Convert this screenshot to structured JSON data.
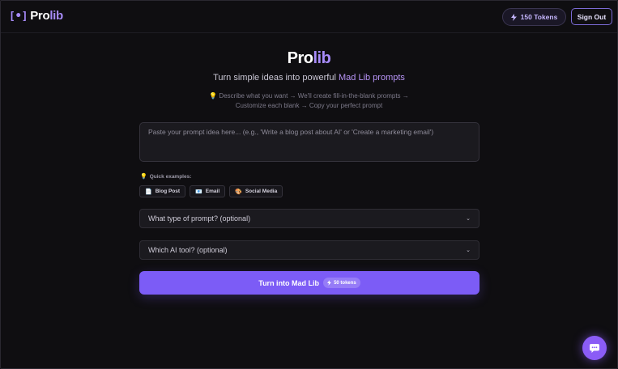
{
  "header": {
    "logo_pro": "Pro",
    "logo_lib": "lib",
    "tokens_label": "150 Tokens",
    "signout_label": "Sign Out"
  },
  "hero": {
    "title_pro": "Pro",
    "title_lib": "lib",
    "tagline_prefix": "Turn simple ideas into powerful",
    "tagline_accent": "Mad Lib prompts",
    "steps_line1": "Describe what you want → We'll create fill-in-the-blank prompts →",
    "steps_line2": "Customize each blank → Copy your perfect prompt"
  },
  "prompt": {
    "placeholder": "Paste your prompt idea here... (e.g., 'Write a blog post about AI' or 'Create a marketing email')",
    "value": ""
  },
  "quick_examples": {
    "label": "Quick examples:",
    "chips": [
      {
        "icon": "document-icon",
        "label": "Blog Post"
      },
      {
        "icon": "email-icon",
        "label": "Email"
      },
      {
        "icon": "palette-icon",
        "label": "Social Media"
      }
    ]
  },
  "selects": {
    "prompt_type": "What type of prompt? (optional)",
    "ai_tool": "Which AI tool? (optional)"
  },
  "cta": {
    "label": "Turn into Mad Lib",
    "badge": "50 tokens"
  },
  "colors": {
    "background": "#0f0e11",
    "accent": "#7c5cf6",
    "accent_light": "#a78bfa",
    "panel": "#1b1a1f"
  }
}
